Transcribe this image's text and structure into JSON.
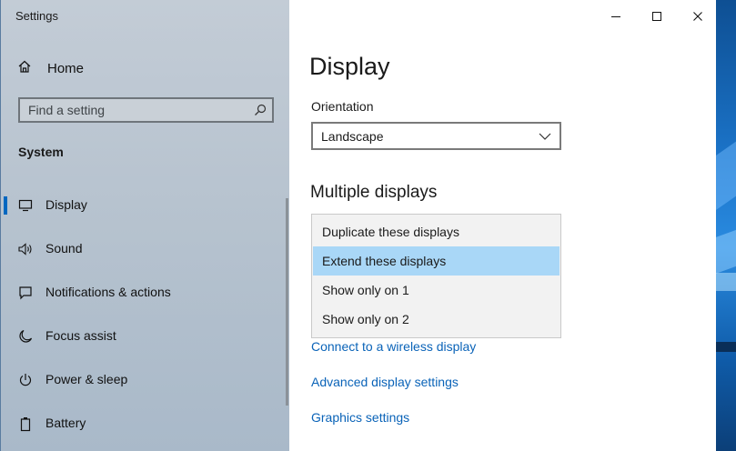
{
  "window": {
    "title": "Settings",
    "controls": {
      "minimize": "—",
      "maximize": "□",
      "close": "✕"
    }
  },
  "sidebar": {
    "home_label": "Home",
    "search": {
      "placeholder": "Find a setting"
    },
    "section": "System",
    "items": [
      {
        "label": "Display",
        "icon": "monitor-icon",
        "selected": true
      },
      {
        "label": "Sound",
        "icon": "speaker-icon",
        "selected": false
      },
      {
        "label": "Notifications & actions",
        "icon": "notification-icon",
        "selected": false
      },
      {
        "label": "Focus assist",
        "icon": "moon-icon",
        "selected": false
      },
      {
        "label": "Power & sleep",
        "icon": "power-icon",
        "selected": false
      },
      {
        "label": "Battery",
        "icon": "battery-icon",
        "selected": false
      }
    ]
  },
  "main": {
    "title": "Display",
    "orientation": {
      "label": "Orientation",
      "value": "Landscape"
    },
    "multiple_displays": {
      "heading": "Multiple displays",
      "options": [
        {
          "label": "Duplicate these displays",
          "highlighted": false
        },
        {
          "label": "Extend these displays",
          "highlighted": true
        },
        {
          "label": "Show only on 1",
          "highlighted": false
        },
        {
          "label": "Show only on 2",
          "highlighted": false
        }
      ]
    },
    "links": {
      "wireless": "Connect to a wireless display",
      "advanced": "Advanced display settings",
      "graphics": "Graphics settings"
    }
  },
  "colors": {
    "accent": "#0067c0",
    "link": "#0a63b8",
    "highlight": "#a9d7f7"
  }
}
